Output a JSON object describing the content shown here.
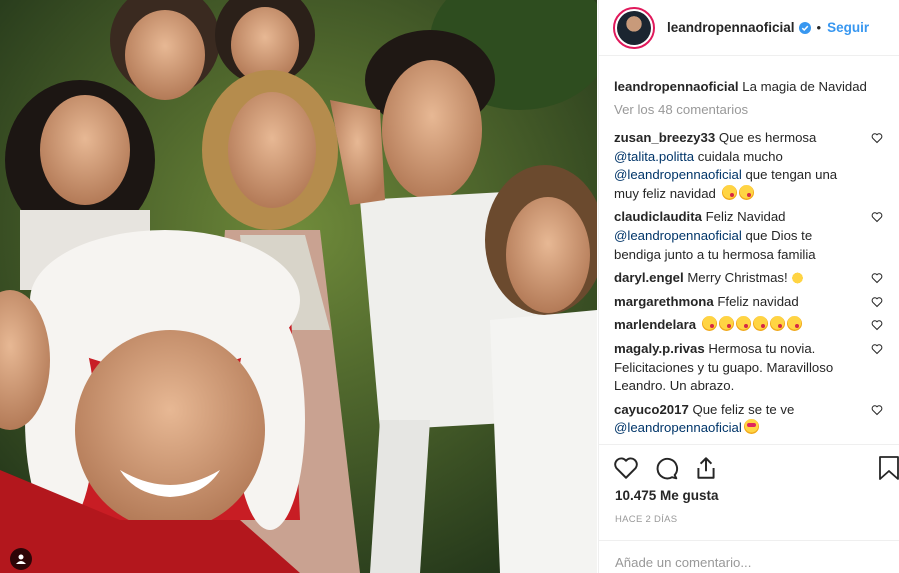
{
  "post": {
    "author": "leandropennaoficial",
    "follow_label": "Seguir",
    "dot": "•",
    "caption": "La magia de Navidad",
    "view_comments": "Ver los 48 comentarios",
    "likes": "10.475 Me gusta",
    "date": "HACE 2 DÍAS",
    "add_comment_placeholder": "Añade un comentario..."
  },
  "comments": [
    {
      "user": "zusan_breezy33",
      "text1": "Que es hermosa",
      "mention1": "@talita.politta",
      "text2": " cuidala mucho",
      "mention2": "@leandropennaoficial",
      "text3": " que tengan una muy feliz navidad"
    },
    {
      "user": "claudiclaudita",
      "text1": "Feliz Navidad",
      "mention1": "@leandropennaoficial",
      "text2": " que Dios te bendiga junto a tu hermosa familia"
    },
    {
      "user": "daryl.engel",
      "text1": "Merry Christmas!"
    },
    {
      "user": "margarethmona",
      "text1": "Ffeliz navidad"
    },
    {
      "user": "marlendelara",
      "text1": ""
    },
    {
      "user": "magaly.p.rivas",
      "text1": "Hermosa tu novia. Felicitaciones y tu guapo. Maravilloso Leandro. Un abrazo."
    },
    {
      "user": "cayuco2017",
      "text1": "Que feliz se te ve",
      "mention1": "@leandropennaoficial"
    }
  ],
  "icons": {
    "like": "heart-icon",
    "comment": "comment-icon",
    "share": "share-icon",
    "save": "bookmark-icon",
    "verified": "verified-badge-icon"
  },
  "colors": {
    "link": "#3897f0",
    "mention": "#003569",
    "muted": "#999999"
  }
}
